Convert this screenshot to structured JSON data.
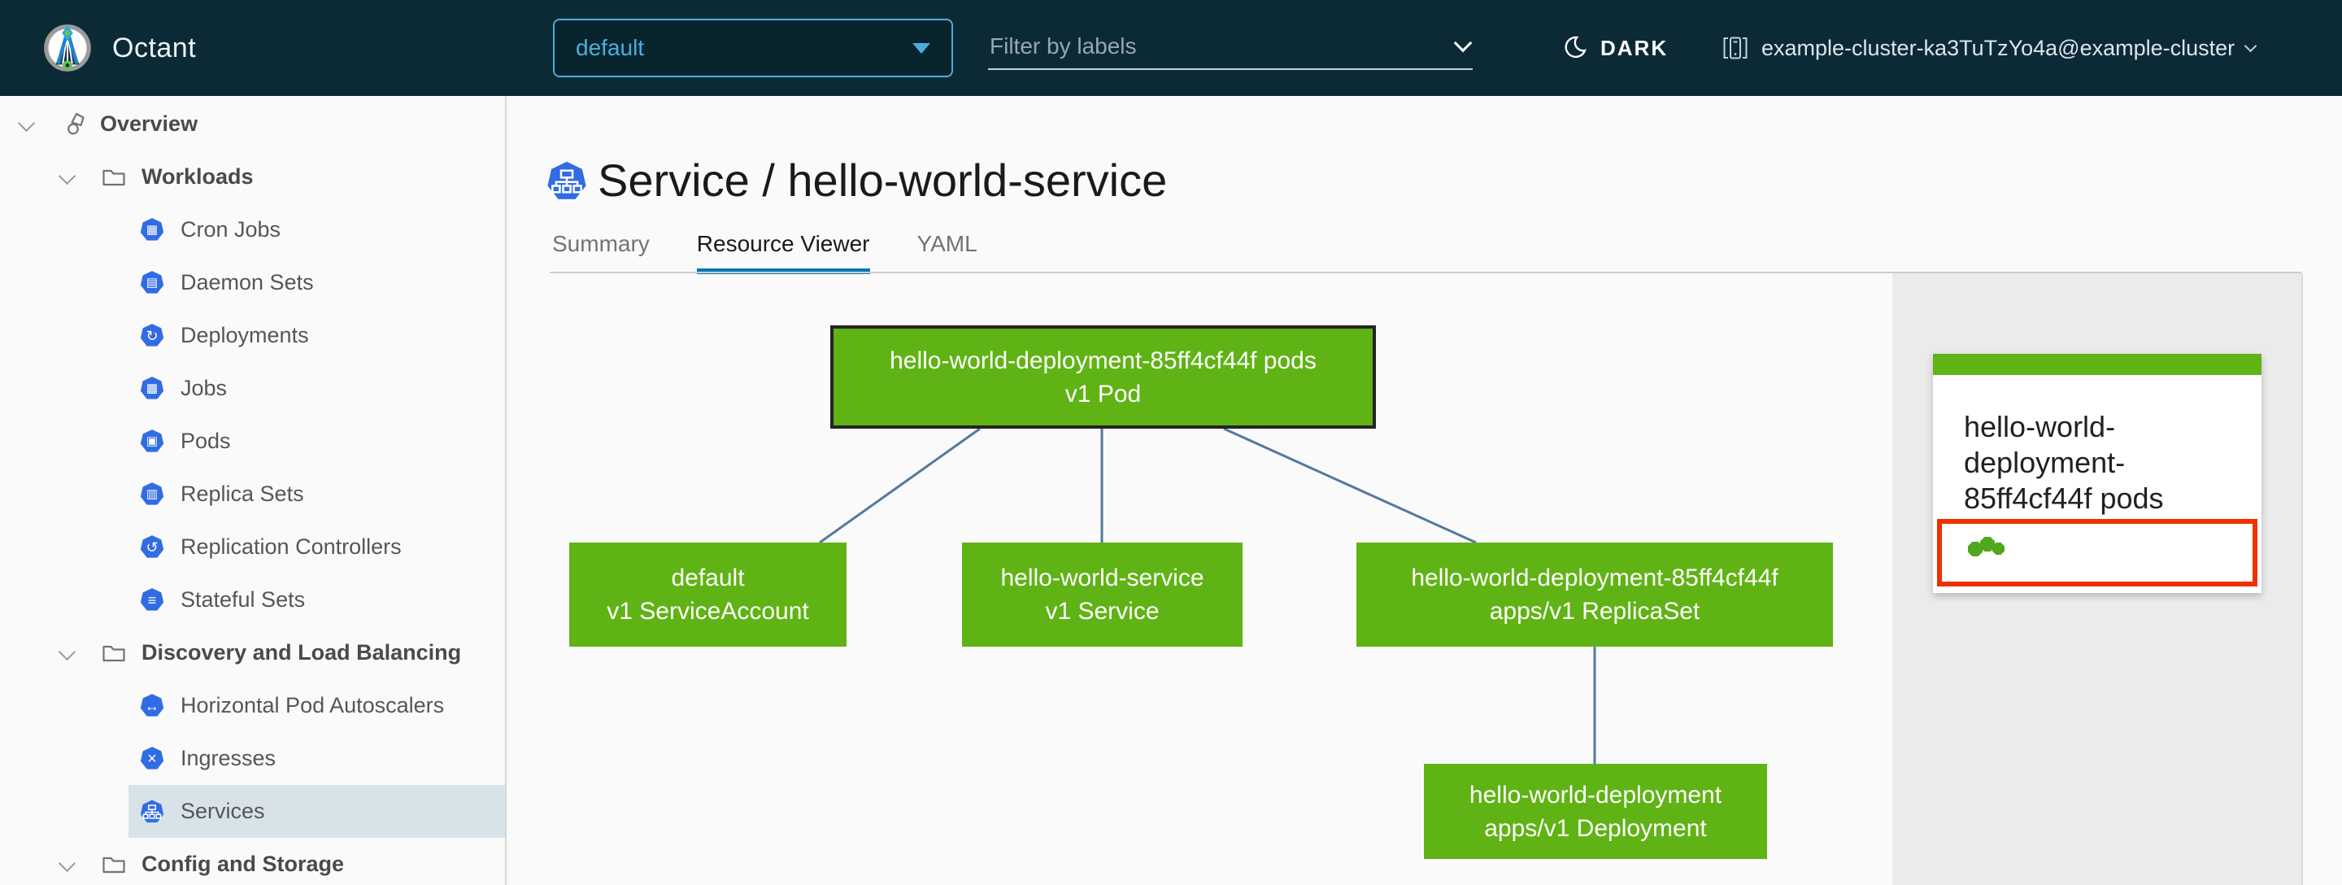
{
  "header": {
    "app_title": "Octant",
    "namespace_selector": {
      "value": "default"
    },
    "label_filter": {
      "placeholder": "Filter by labels"
    },
    "theme_toggle": {
      "label": "DARK"
    },
    "cluster_selector": {
      "value": "example-cluster-ka3TuTzYo4a@example-cluster"
    }
  },
  "sidebar": {
    "items": [
      {
        "label": "Overview",
        "icon": "applications-icon",
        "level": "root"
      },
      {
        "label": "Workloads",
        "icon": "folder-icon",
        "level": "group"
      },
      {
        "label": "Cron Jobs",
        "icon": "k8s-cronjob-icon",
        "level": "leaf"
      },
      {
        "label": "Daemon Sets",
        "icon": "k8s-daemonset-icon",
        "level": "leaf"
      },
      {
        "label": "Deployments",
        "icon": "k8s-deployment-icon",
        "level": "leaf"
      },
      {
        "label": "Jobs",
        "icon": "k8s-job-icon",
        "level": "leaf"
      },
      {
        "label": "Pods",
        "icon": "k8s-pod-icon",
        "level": "leaf"
      },
      {
        "label": "Replica Sets",
        "icon": "k8s-replicaset-icon",
        "level": "leaf"
      },
      {
        "label": "Replication Controllers",
        "icon": "k8s-replicationcontroller-icon",
        "level": "leaf"
      },
      {
        "label": "Stateful Sets",
        "icon": "k8s-statefulset-icon",
        "level": "leaf"
      },
      {
        "label": "Discovery and Load Balancing",
        "icon": "folder-icon",
        "level": "group"
      },
      {
        "label": "Horizontal Pod Autoscalers",
        "icon": "k8s-hpa-icon",
        "level": "leaf"
      },
      {
        "label": "Ingresses",
        "icon": "k8s-ingress-icon",
        "level": "leaf"
      },
      {
        "label": "Services",
        "icon": "k8s-service-icon",
        "level": "leaf",
        "selected": true
      },
      {
        "label": "Config and Storage",
        "icon": "folder-icon",
        "level": "group"
      }
    ]
  },
  "main": {
    "page_title": "Service / hello-world-service",
    "tabs": [
      {
        "label": "Summary",
        "active": false
      },
      {
        "label": "Resource Viewer",
        "active": true
      },
      {
        "label": "YAML",
        "active": false
      }
    ]
  },
  "resource_graph": {
    "nodes": [
      {
        "id": "pod",
        "line1": "hello-world-deployment-85ff4cf44f pods",
        "line2": "v1 Pod",
        "selected": true
      },
      {
        "id": "serviceaccount",
        "line1": "default",
        "line2": "v1 ServiceAccount",
        "selected": false
      },
      {
        "id": "service",
        "line1": "hello-world-service",
        "line2": "v1 Service",
        "selected": false
      },
      {
        "id": "replicaset",
        "line1": "hello-world-deployment-85ff4cf44f",
        "line2": "apps/v1 ReplicaSet",
        "selected": false
      },
      {
        "id": "deployment",
        "line1": "hello-world-deployment",
        "line2": "apps/v1 Deployment",
        "selected": false
      }
    ],
    "edges": [
      {
        "from": "pod",
        "to": "serviceaccount"
      },
      {
        "from": "pod",
        "to": "service"
      },
      {
        "from": "pod",
        "to": "replicaset"
      },
      {
        "from": "replicaset",
        "to": "deployment"
      }
    ]
  },
  "minimap": {
    "card_title": "hello-world-deployment-85ff4cf44f pods",
    "pod_count": 3
  },
  "colors": {
    "header_bg": "#0C2A36",
    "accent_blue": "#49AFD9",
    "k8s_blue": "#326CE5",
    "node_green": "#60B315",
    "edge_blue": "#55789F",
    "alert_red": "#EE3100",
    "tab_underline": "#0E76BA",
    "selected_row_bg": "#D8E3E9"
  }
}
